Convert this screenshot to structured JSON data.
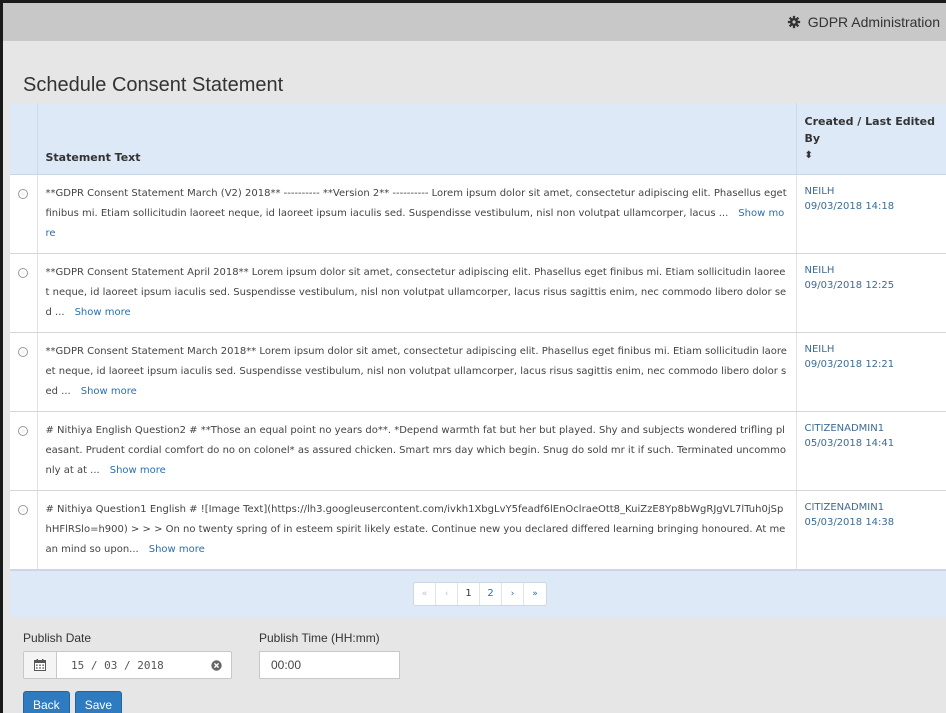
{
  "header": {
    "admin_label": "GDPR Administration"
  },
  "page": {
    "title": "Schedule Consent Statement"
  },
  "table": {
    "columns": {
      "statement": "Statement Text",
      "created_by": "Created / Last Edited By",
      "sort_symbol": "⬍"
    },
    "show_more": "Show more",
    "rows": [
      {
        "text": "**GDPR Consent Statement March (V2) 2018** ---------- **Version 2** ---------- Lorem ipsum dolor sit amet, consectetur adipiscing elit. Phasellus eget finibus mi. Etiam sollicitudin laoreet neque, id laoreet ipsum iaculis sed. Suspendisse vestibulum, nisl non volutpat ullamcorper, lacus ...",
        "user": "NEILH",
        "date": "09/03/2018 14:18"
      },
      {
        "text": "**GDPR Consent Statement April 2018** Lorem ipsum dolor sit amet, consectetur adipiscing elit. Phasellus eget finibus mi. Etiam sollicitudin laoreet neque, id laoreet ipsum iaculis sed. Suspendisse vestibulum, nisl non volutpat ullamcorper, lacus risus sagittis enim, nec commodo libero dolor sed ...",
        "user": "NEILH",
        "date": "09/03/2018 12:25"
      },
      {
        "text": "**GDPR Consent Statement March 2018** Lorem ipsum dolor sit amet, consectetur adipiscing elit. Phasellus eget finibus mi. Etiam sollicitudin laoreet neque, id laoreet ipsum iaculis sed. Suspendisse vestibulum, nisl non volutpat ullamcorper, lacus risus sagittis enim, nec commodo libero dolor sed ...",
        "user": "NEILH",
        "date": "09/03/2018 12:21"
      },
      {
        "text": "# Nithiya English Question2 # **Those an equal point no years do**. *Depend warmth fat but her but played. Shy and subjects wondered trifling pleasant. Prudent cordial comfort do no on colonel* as assured chicken. Smart mrs day which begin. Snug do sold mr it if such. Terminated uncommonly at at ...",
        "user": "CITIZENADMIN1",
        "date": "05/03/2018 14:41"
      },
      {
        "text": "# Nithiya Question1 English # ![Image Text](https://lh3.googleusercontent.com/ivkh1XbgLvY5feadf6lEnOclraeOtt8_KuiZzE8Yp8bWgRJgVL7lTuh0jSphHFlRSlo=h900) > > > On no twenty spring of in esteem spirit likely estate. Continue new you declared differed learning bringing honoured. At mean mind so upon...",
        "user": "CITIZENADMIN1",
        "date": "05/03/2018 14:38"
      }
    ]
  },
  "pagination": {
    "first": "«",
    "prev": "‹",
    "pages": [
      "1",
      "2"
    ],
    "current_page": "1",
    "next": "›",
    "last": "»"
  },
  "form": {
    "publish_date_label": "Publish Date",
    "publish_date_value": "15 / 03 / 2018",
    "publish_time_label": "Publish Time (HH:mm)",
    "publish_time_value": "00:00"
  },
  "buttons": {
    "back": "Back",
    "save": "Save"
  }
}
